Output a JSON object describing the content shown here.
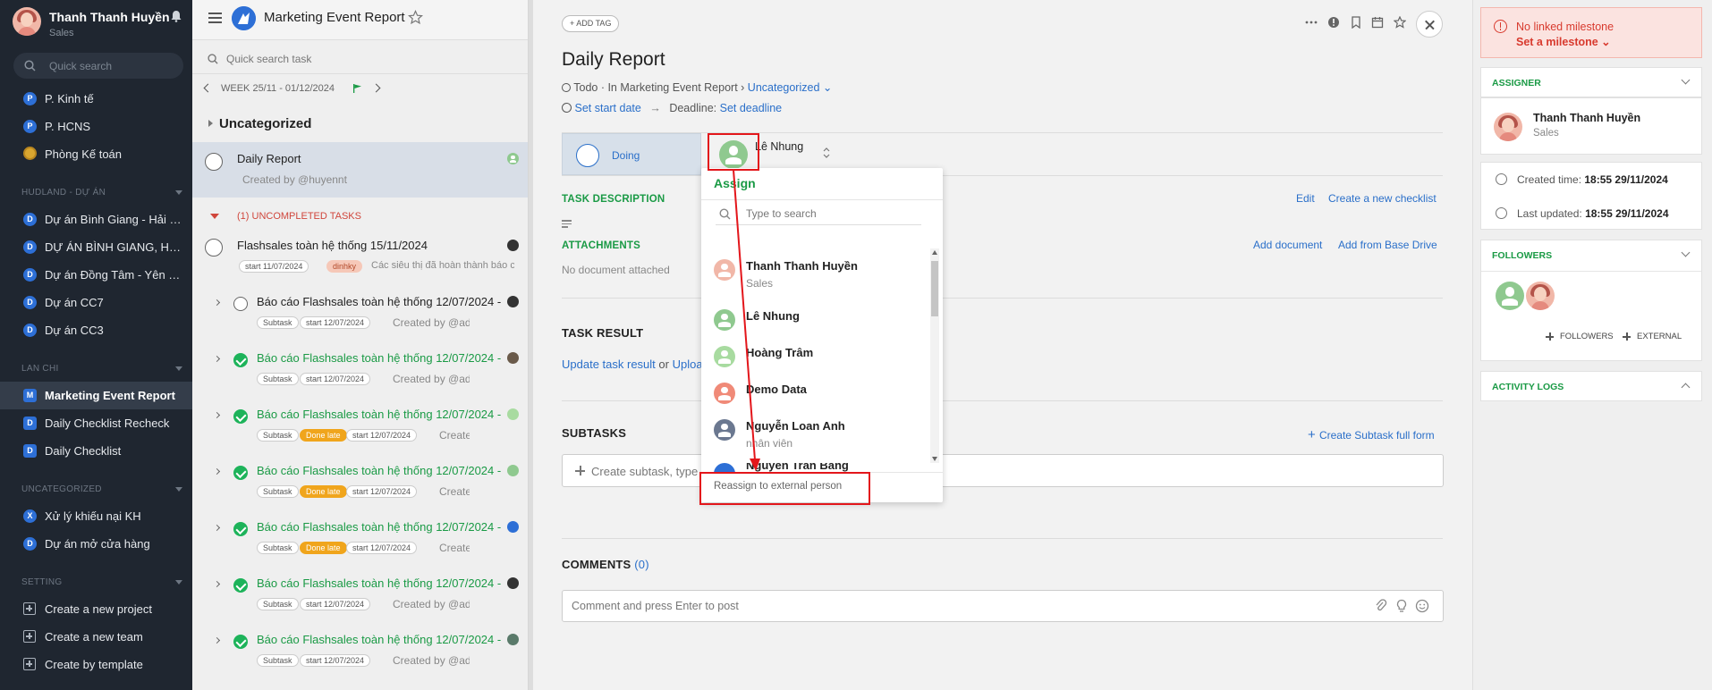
{
  "sidebar": {
    "user_name": "Thanh Thanh Huyền",
    "user_role": "Sales",
    "search_placeholder": "Quick search",
    "items_top": [
      "P. Kinh tế",
      "P. HCNS",
      "Phòng Kế toán"
    ],
    "badges_top": [
      "P",
      "P",
      ""
    ],
    "section_hudland": "HUDLAND - DỰ ÁN",
    "items_hudland": [
      "Dự án Bình Giang - Hải D...",
      "DỰ ÁN BÌNH GIANG, HẢI ...",
      "Dự án Đồng Tâm - Yên Bái",
      "Dự án CC7",
      "Dự án CC3"
    ],
    "section_lanchi": "LAN CHI",
    "items_lanchi": [
      "Marketing Event Report",
      "Daily Checklist Recheck",
      "Daily Checklist"
    ],
    "badges_lanchi": [
      "M",
      "D",
      "D"
    ],
    "section_uncat": "UNCATEGORIZED",
    "items_uncat": [
      "Xử lý khiếu nại KH",
      "Dự án mở cửa hàng"
    ],
    "badges_uncat": [
      "X",
      "D"
    ],
    "section_setting": "SETTING",
    "items_setting": [
      "Create a new project",
      "Create a new team",
      "Create by template"
    ]
  },
  "list": {
    "project_title": "Marketing Event Report",
    "search_placeholder": "Quick search task",
    "week": "WEEK 25/11 - 01/12/2024",
    "group": "Uncategorized",
    "selected_task": {
      "name": "Daily Report",
      "sub": "Created by @huyennt"
    },
    "uncompleted": "(1) UNCOMPLETED TASKS",
    "task2": {
      "name": "Flashsales toàn hệ thống 15/11/2024",
      "tag_start": "start 11/07/2024",
      "tag_label": "dinhky",
      "desc": "Các siêu thị đã hoàn thành báo cáo"
    },
    "subtasks": [
      {
        "name": "Báo cáo Flashsales toàn hệ thống 12/07/2024 - ...",
        "tags": [
          "Subtask",
          "start 12/07/2024"
        ],
        "created": "Created by @admin"
      },
      {
        "name": "Báo cáo Flashsales toàn hệ thống 12/07/2024 - ...",
        "tags": [
          "Subtask",
          "start 12/07/2024"
        ],
        "created": "Created by @admin"
      },
      {
        "name": "Báo cáo Flashsales toàn hệ thống 12/07/2024 - ...",
        "tags": [
          "Subtask",
          "Done late",
          "start 12/07/2024"
        ],
        "created": "Created by @admin"
      },
      {
        "name": "Báo cáo Flashsales toàn hệ thống 12/07/2024 - ...",
        "tags": [
          "Subtask",
          "Done late",
          "start 12/07/2024"
        ],
        "created": "Created by @admin"
      },
      {
        "name": "Báo cáo Flashsales toàn hệ thống 12/07/2024 - ...",
        "tags": [
          "Subtask",
          "Done late",
          "start 12/07/2024"
        ],
        "created": "Created by @admin"
      },
      {
        "name": "Báo cáo Flashsales toàn hệ thống 12/07/2024 - ...",
        "tags": [
          "Subtask",
          "start 12/07/2024"
        ],
        "created": "Created by @admin"
      },
      {
        "name": "Báo cáo Flashsales toàn hệ thống 12/07/2024 - ...",
        "tags": [
          "Subtask",
          "start 12/07/2024"
        ],
        "created": "Created by @admin"
      }
    ]
  },
  "main": {
    "add_tag": "ADD TAG",
    "title": "Daily Report",
    "meta_status": "Todo · In Marketing Event Report ›",
    "meta_category": "Uncategorized",
    "set_start": "Set start date",
    "deadline_label": "Deadline:",
    "set_deadline": "Set deadline",
    "status": "Doing",
    "assignee": "Lê Nhung",
    "task_description": "TASK DESCRIPTION",
    "edit": "Edit",
    "create_checklist": "Create a new checklist",
    "attachments": "ATTACHMENTS",
    "no_doc": "No document attached",
    "add_document": "Add document",
    "add_from_drive": "Add from Base Drive",
    "task_result": "TASK RESULT",
    "update_result": "Update task result",
    "or": "or",
    "upload": "Uploa",
    "subtasks": "SUBTASKS",
    "create_subtask_full": "Create Subtask full form",
    "subtask_placeholder": "Create subtask, type",
    "comments": "COMMENTS",
    "comments_count": "(0)",
    "comment_placeholder": "Comment and press Enter to post"
  },
  "dropdown": {
    "title": "Assign",
    "search_placeholder": "Type to search",
    "people": [
      {
        "name": "Thanh Thanh Huyền",
        "role": "Sales",
        "color": "#f1b7a8"
      },
      {
        "name": "Lê Nhung",
        "role": "",
        "color": "#8fc98f"
      },
      {
        "name": "Hoàng Trâm",
        "role": "",
        "color": "#a8dba0"
      },
      {
        "name": "Demo Data",
        "role": "",
        "color": "#f08a78"
      },
      {
        "name": "Nguyễn Loan Anh",
        "role": "nhân viên",
        "color": "#6b7890"
      }
    ],
    "partial_name": "Nguyễn Trần Bang",
    "footer": "Reassign to external person"
  },
  "right": {
    "no_milestone": "No linked milestone",
    "set_milestone": "Set a milestone",
    "assigner": "ASSIGNER",
    "assigner_name": "Thanh Thanh Huyền",
    "assigner_role": "Sales",
    "created_label": "Created time:",
    "created_value": "18:55 29/11/2024",
    "updated_label": "Last updated:",
    "updated_value": "18:55 29/11/2024",
    "followers": "FOLLOWERS",
    "add_followers": "FOLLOWERS",
    "add_external": "EXTERNAL",
    "activity_logs": "ACTIVITY LOGS"
  }
}
